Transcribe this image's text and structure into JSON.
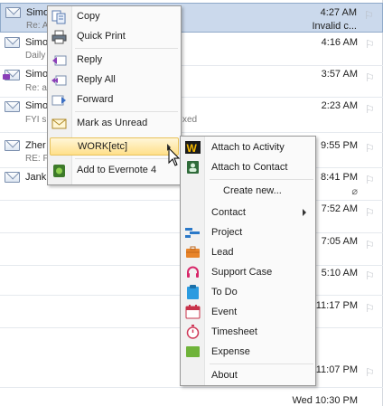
{
  "mail_list": {
    "items": [
      {
        "sender": "Simo",
        "preview": "Re: A",
        "time": "4:27 AM",
        "sub": "Invalid c...",
        "selected": true
      },
      {
        "sender": "Simo",
        "preview": "Daily",
        "time": "4:16 AM",
        "sub": "",
        "selected": false
      },
      {
        "sender": "Simo",
        "preview": "Re: a",
        "time": "3:57 AM",
        "sub": "",
        "selected": false
      },
      {
        "sender": "Simo",
        "preview": "FYI s",
        "time": "2:23 AM",
        "sub": "",
        "selected": false
      },
      {
        "sender": "Zher",
        "preview": "RE: F",
        "time": "9:55 PM",
        "sub": "",
        "selected": false
      },
      {
        "sender": "Jank",
        "preview": "",
        "time": "8:41 PM",
        "sub": "",
        "selected": false
      },
      {
        "sender": "",
        "preview": "",
        "time": "7:52 AM",
        "sub": "",
        "selected": false
      },
      {
        "sender": "",
        "preview": "",
        "time": "7:05 AM",
        "sub": "",
        "selected": false
      },
      {
        "sender": "",
        "preview": "",
        "time": "5:10 AM",
        "sub": "",
        "selected": false
      },
      {
        "sender": "",
        "preview": "",
        "time": "11:17 PM",
        "sub": "",
        "selected": false
      },
      {
        "sender": "",
        "preview": "",
        "time": "11:07 PM",
        "sub": "",
        "selected": false
      },
      {
        "sender": "",
        "preview": "",
        "time": "Wed 10:30 PM",
        "sub": "",
        "selected": false
      }
    ],
    "hidden_fragment": "xed"
  },
  "context_menu": {
    "items": [
      {
        "label": "Copy",
        "icon": "copy-icon"
      },
      {
        "label": "Quick Print",
        "icon": "printer-icon"
      },
      {
        "label": "Reply",
        "icon": "reply-icon"
      },
      {
        "label": "Reply All",
        "icon": "reply-all-icon"
      },
      {
        "label": "Forward",
        "icon": "forward-icon"
      },
      {
        "label": "Mark as Unread",
        "icon": "envelope-icon"
      },
      {
        "label": "WORK[etc]",
        "icon": ""
      },
      {
        "label": "Add to Evernote 4",
        "icon": "evernote-icon"
      }
    ]
  },
  "submenu": {
    "items": [
      {
        "label": "Attach to Activity",
        "icon": "work-etc-logo-icon"
      },
      {
        "label": "Attach to Contact",
        "icon": "attach-contact-icon"
      },
      {
        "label": "Create new...",
        "icon": ""
      },
      {
        "label": "Contact",
        "icon": ""
      },
      {
        "label": "Project",
        "icon": "project-icon"
      },
      {
        "label": "Lead",
        "icon": "briefcase-icon"
      },
      {
        "label": "Support Case",
        "icon": "headset-icon"
      },
      {
        "label": "To Do",
        "icon": "clipboard-icon"
      },
      {
        "label": "Event",
        "icon": "calendar-icon"
      },
      {
        "label": "Timesheet",
        "icon": "stopwatch-icon"
      },
      {
        "label": "Expense",
        "icon": "expense-icon"
      },
      {
        "label": "About",
        "icon": ""
      }
    ]
  },
  "colors": {
    "selection": "#cbd9ec",
    "highlight": "#ffe08a",
    "menu_bg": "#fafafa"
  }
}
